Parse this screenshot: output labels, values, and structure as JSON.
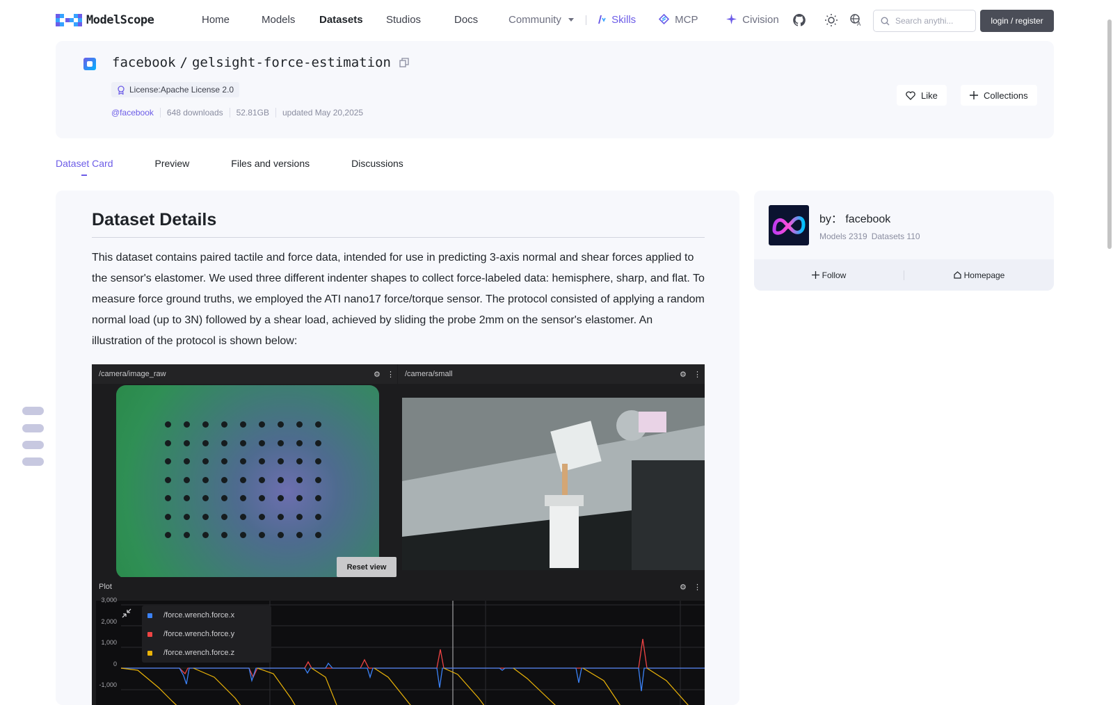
{
  "nav": {
    "logo_text": "ModelScope",
    "items": [
      "Home",
      "Models",
      "Datasets",
      "Studios",
      "Docs",
      "Community"
    ],
    "skills": "Skills",
    "mcp": "MCP",
    "civision": "Civision",
    "search_placeholder": "Search anythi...",
    "login_label": "login / register"
  },
  "dataset": {
    "owner": "facebook",
    "separator": "/",
    "name": "gelsight-force-estimation",
    "license": "License:Apache License 2.0",
    "owner_handle": "@facebook",
    "downloads": "648 downloads",
    "size": "52.81GB",
    "updated": "updated May 20,2025",
    "like_label": "Like",
    "collections_label": "Collections"
  },
  "tabs": [
    "Dataset Card",
    "Preview",
    "Files and versions",
    "Discussions"
  ],
  "card": {
    "heading": "Dataset Details",
    "paragraph": "This dataset contains paired tactile and force data, intended for use in predicting 3-axis normal and shear forces applied to the sensor's elastomer. We used three different indenter shapes to collect force-labeled data: hemisphere, sharp, and flat. To measure force ground truths, we employed the ATI nano17 force/torque sensor. The protocol consisted of applying a random normal load (up to 3N) followed by a shear load, achieved by sliding the probe 2mm on the sensor's elastomer. An illustration of the protocol is shown below:"
  },
  "embedded": {
    "panel_left": "/camera/image_raw",
    "panel_right": "/camera/small",
    "panel_plot": "Plot",
    "reset_label": "Reset view",
    "y_ticks": [
      "3,000",
      "2,000",
      "1,000",
      "0",
      "-1,000"
    ],
    "legend": [
      {
        "label": "/force.wrench.force.x",
        "color": "#3b82f6"
      },
      {
        "label": "/force.wrench.force.y",
        "color": "#ef4444"
      },
      {
        "label": "/force.wrench.force.z",
        "color": "#eab308"
      }
    ]
  },
  "sidebar": {
    "by_prefix": "by：",
    "org": "facebook",
    "models": "Models 2319",
    "datasets": "Datasets 110",
    "follow_label": "Follow",
    "homepage_label": "Homepage"
  },
  "colors": {
    "accent": "#6c5ce7",
    "card_bg": "#f7f8fc"
  }
}
